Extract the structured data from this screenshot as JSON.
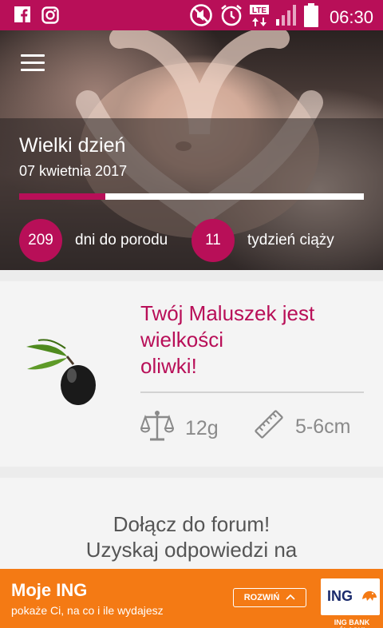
{
  "status_bar": {
    "time": "06:30",
    "network": "LTE",
    "left_icons": [
      "facebook-icon",
      "instagram-icon"
    ],
    "right_icons": [
      "mute-icon",
      "alarm-icon",
      "lte-icon",
      "signal-icon",
      "battery-icon"
    ]
  },
  "hero": {
    "title": "Wielki dzień",
    "date": "07 kwietnia 2017",
    "progress": 0.25,
    "days_count": "209",
    "days_label": "dni do porodu",
    "week_count": "11",
    "week_label": "tydzień ciąży"
  },
  "baby_size": {
    "title_line1": "Twój Maluszek jest",
    "title_line2": "wielkości",
    "title_line3": "oliwki!",
    "weight": "12g",
    "length": "5-6cm",
    "fruit_icon": "olive-icon"
  },
  "forum": {
    "line1": "Dołącz do forum!",
    "line2": "Uzyskaj odpowiedzi na"
  },
  "ad": {
    "title": "Moje ING",
    "subtitle": "pokaże Ci, na co i ile wydajesz",
    "button": "ROZWIŃ",
    "logo": "ING",
    "bank": "ING BANK ŚLĄSKI"
  },
  "colors": {
    "accent": "#b80f58",
    "ad_orange": "#f47a14"
  }
}
